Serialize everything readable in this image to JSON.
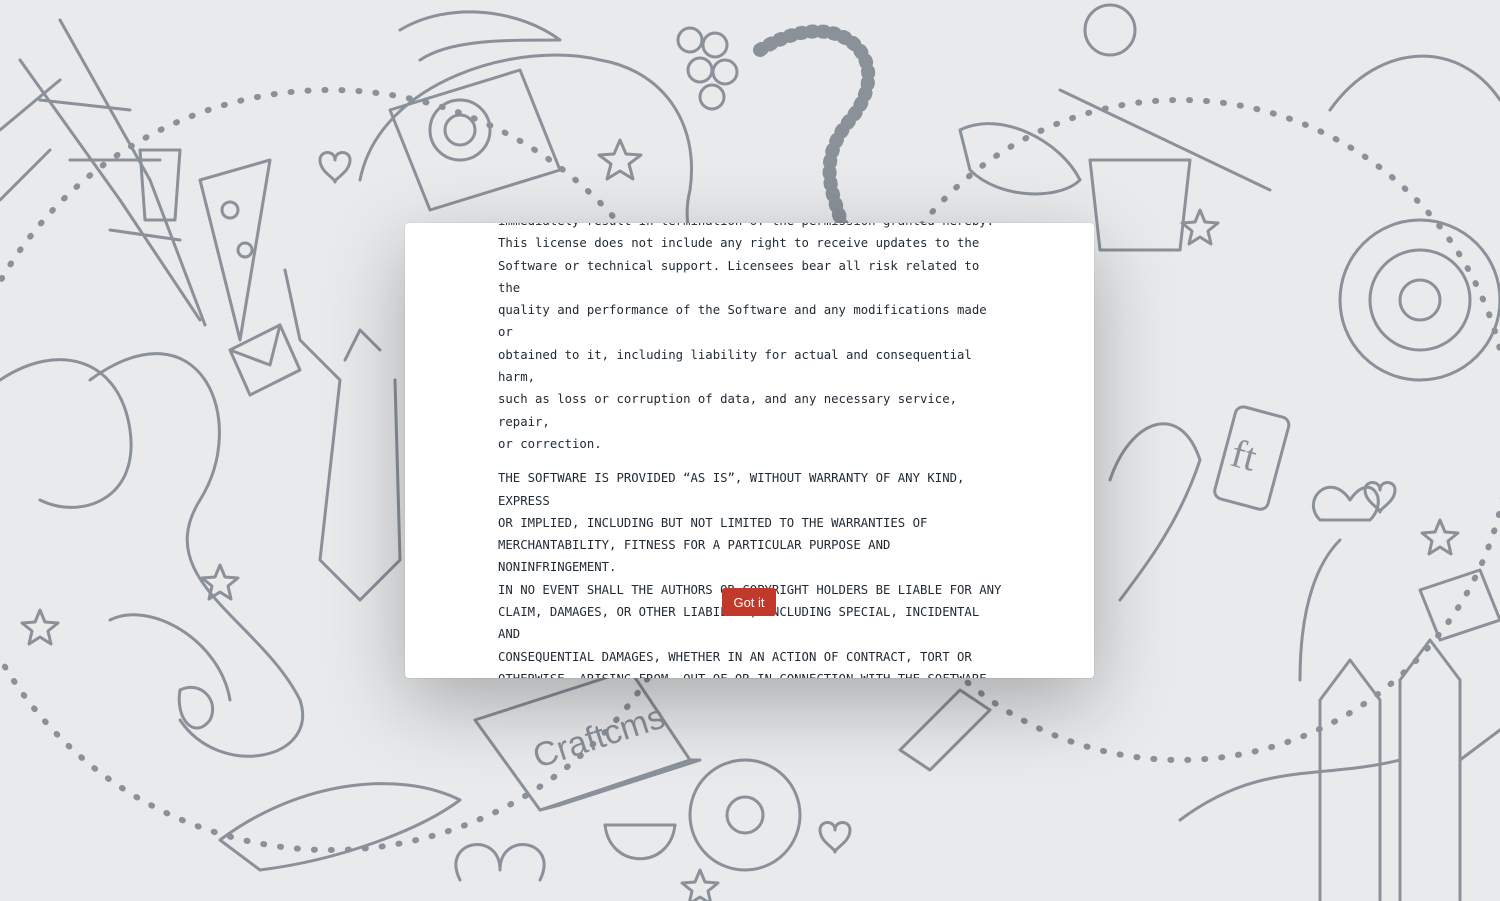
{
  "license": {
    "paragraphs": [
      "immediately result in termination of the permission granted hereby.\nThis license does not include any right to receive updates to the\nSoftware or technical support. Licensees bear all risk related to the\nquality and performance of the Software and any modifications made or\nobtained to it, including liability for actual and consequential harm,\nsuch as loss or corruption of data, and any necessary service, repair,\nor correction.",
      "THE SOFTWARE IS PROVIDED “AS IS”, WITHOUT WARRANTY OF ANY KIND, EXPRESS\nOR IMPLIED, INCLUDING BUT NOT LIMITED TO THE WARRANTIES OF\nMERCHANTABILITY, FITNESS FOR A PARTICULAR PURPOSE AND NONINFRINGEMENT.\nIN NO EVENT SHALL THE AUTHORS OR COPYRIGHT HOLDERS BE LIABLE FOR ANY\nCLAIM, DAMAGES, OR OTHER LIABILITY, INCLUDING SPECIAL, INCIDENTAL AND\nCONSEQUENTIAL DAMAGES, WHETHER IN AN ACTION OF CONTRACT, TORT OR\nOTHERWISE, ARISING FROM, OUT OF OR IN CONNECTION WITH THE SOFTWARE OR\nTHE USE OR OTHER DEALINGS IN THE SOFTWARE."
    ]
  },
  "button": {
    "label": "Got it",
    "color": "#c0392b"
  },
  "background": {
    "color": "#e8eaec",
    "line_color": "#8a9199",
    "illustration": "doodle-pattern",
    "laptop_text": "Craftcms",
    "phone_text": "ft"
  }
}
